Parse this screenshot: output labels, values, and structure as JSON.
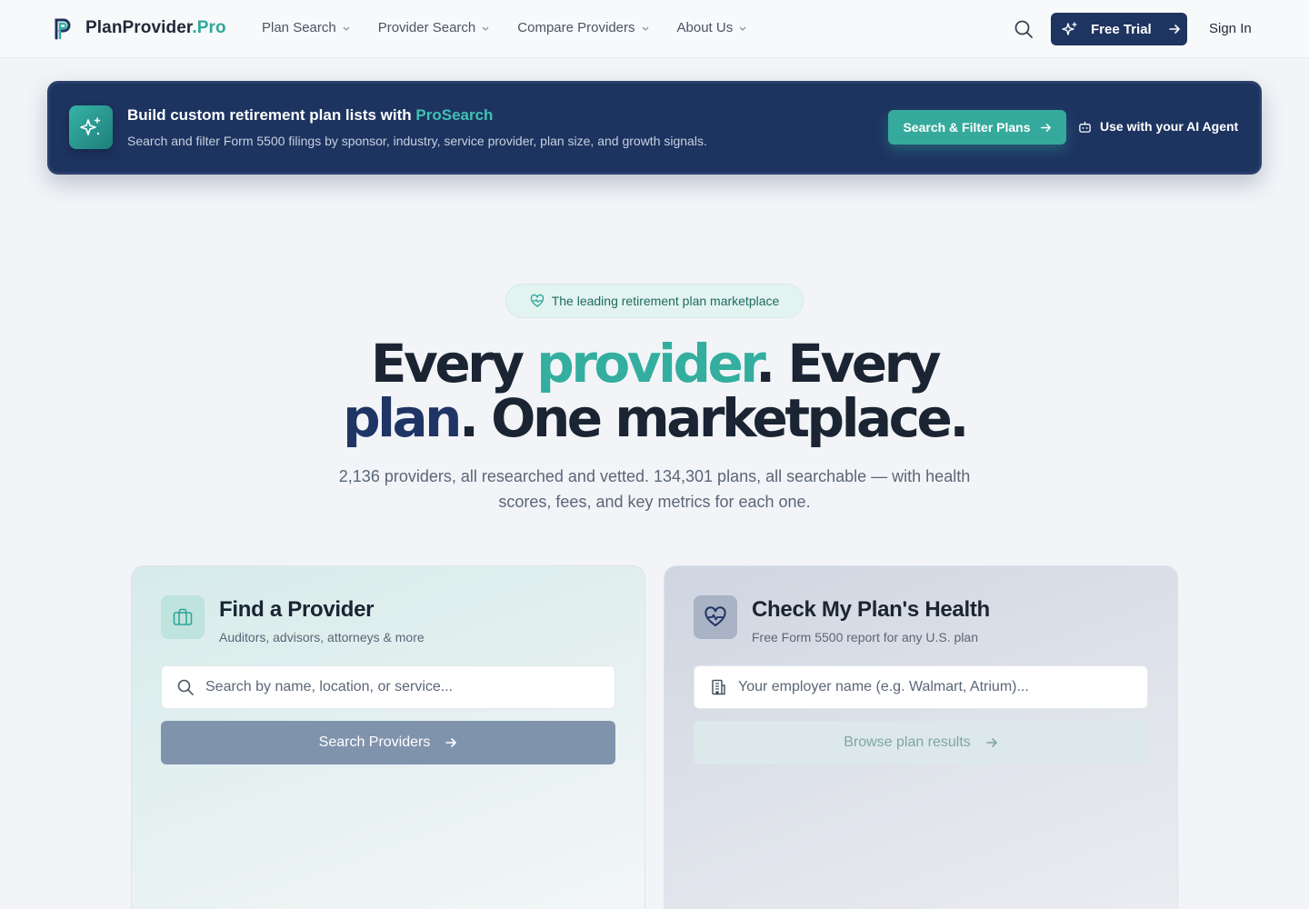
{
  "nav": {
    "logo_name": "PlanProvider",
    "logo_suffix": ".Pro",
    "menu": [
      {
        "label": "Plan Search"
      },
      {
        "label": "Provider Search"
      },
      {
        "label": "Compare Providers"
      },
      {
        "label": "About Us"
      }
    ],
    "trial_label": "Free Trial",
    "signin_label": "Sign In"
  },
  "banner": {
    "title_prefix": "Build custom retirement plan lists with ",
    "title_accent": "ProSearch",
    "subtitle": "Search and filter Form 5500 filings by sponsor, industry, service provider, plan size, and growth signals.",
    "cta_label": "Search & Filter Plans",
    "ai_label": "Use with your AI Agent"
  },
  "hero": {
    "pill": "The leading retirement plan marketplace",
    "headline": {
      "part1": "Every ",
      "accent1": "provider",
      "part2": ". Every",
      "accent2": "plan",
      "part3": ". One marketplace."
    },
    "subhead": "2,136 providers, all researched and vetted. 134,301 plans, all searchable — with health scores, fees, and key metrics for each one."
  },
  "cards": {
    "find": {
      "title": "Find a Provider",
      "subtitle": "Auditors, advisors, attorneys & more",
      "placeholder": "Search by name, location, or service...",
      "button": "Search Providers"
    },
    "health": {
      "title": "Check My Plan's Health",
      "subtitle": "Free Form 5500 report for any U.S. plan",
      "placeholder": "Your employer name (e.g. Walmart, Atrium)...",
      "button": "Browse plan results"
    }
  },
  "colors": {
    "brand_navy": "#1e3461",
    "brand_teal": "#33ae9f",
    "background": "#f2f4f7"
  },
  "icons": [
    "logo-icon",
    "chevron-down-icon",
    "search-icon",
    "sparkles-icon",
    "arrow-right-icon",
    "bot-icon",
    "heart-pulse-icon",
    "briefcase-icon",
    "building-icon"
  ]
}
